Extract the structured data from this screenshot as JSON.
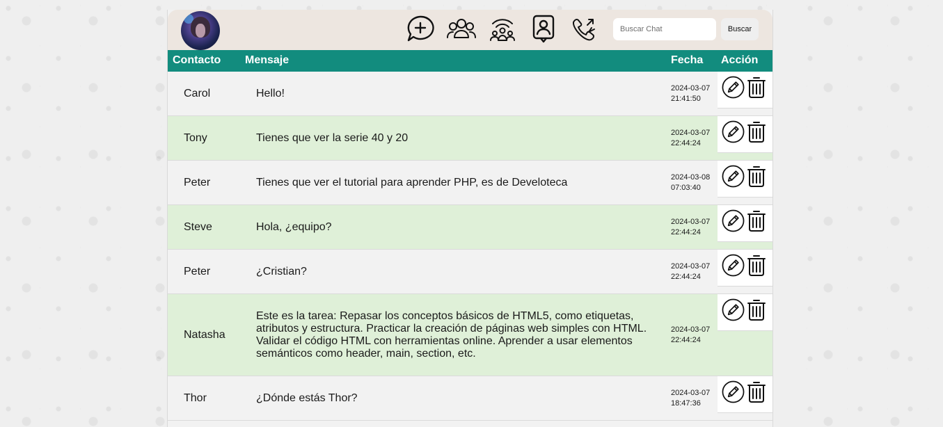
{
  "header": {
    "icons": [
      "new-chat-icon",
      "community-icon",
      "groups-icon",
      "contacts-icon",
      "calls-icon"
    ],
    "search_placeholder": "Buscar Chat",
    "search_button": "Buscar"
  },
  "table": {
    "headers": {
      "contact": "Contacto",
      "message": "Mensaje",
      "date": "Fecha",
      "action": "Acción"
    },
    "rows": [
      {
        "contact": "Carol",
        "message": "Hello!",
        "date": "2024-03-07",
        "time": "21:41:50"
      },
      {
        "contact": "Tony",
        "message": "Tienes que ver la serie 40 y 20",
        "date": "2024-03-07",
        "time": "22:44:24"
      },
      {
        "contact": "Peter",
        "message": "Tienes que ver el tutorial para aprender PHP, es de Develoteca",
        "date": "2024-03-08",
        "time": "07:03:40"
      },
      {
        "contact": "Steve",
        "message": "Hola, ¿equipo?",
        "date": "2024-03-07",
        "time": "22:44:24"
      },
      {
        "contact": "Peter",
        "message": "¿Cristian?",
        "date": "2024-03-07",
        "time": "22:44:24"
      },
      {
        "contact": "Natasha",
        "message": "Este es la tarea: Repasar los conceptos básicos de HTML5, como etiquetas, atributos y estructura. Practicar la creación de páginas web simples con HTML. Validar el código HTML con herramientas online. Aprender a usar elementos semánticos como header, main, section, etc.",
        "date": "2024-03-07",
        "time": "22:44:24"
      },
      {
        "contact": "Thor",
        "message": "¿Dónde estás Thor?",
        "date": "2024-03-07",
        "time": "18:47:36"
      }
    ]
  },
  "colors": {
    "header_bar": "#128c7e",
    "row_alt": "#dff0d8",
    "top_bar": "#ede6e0"
  }
}
